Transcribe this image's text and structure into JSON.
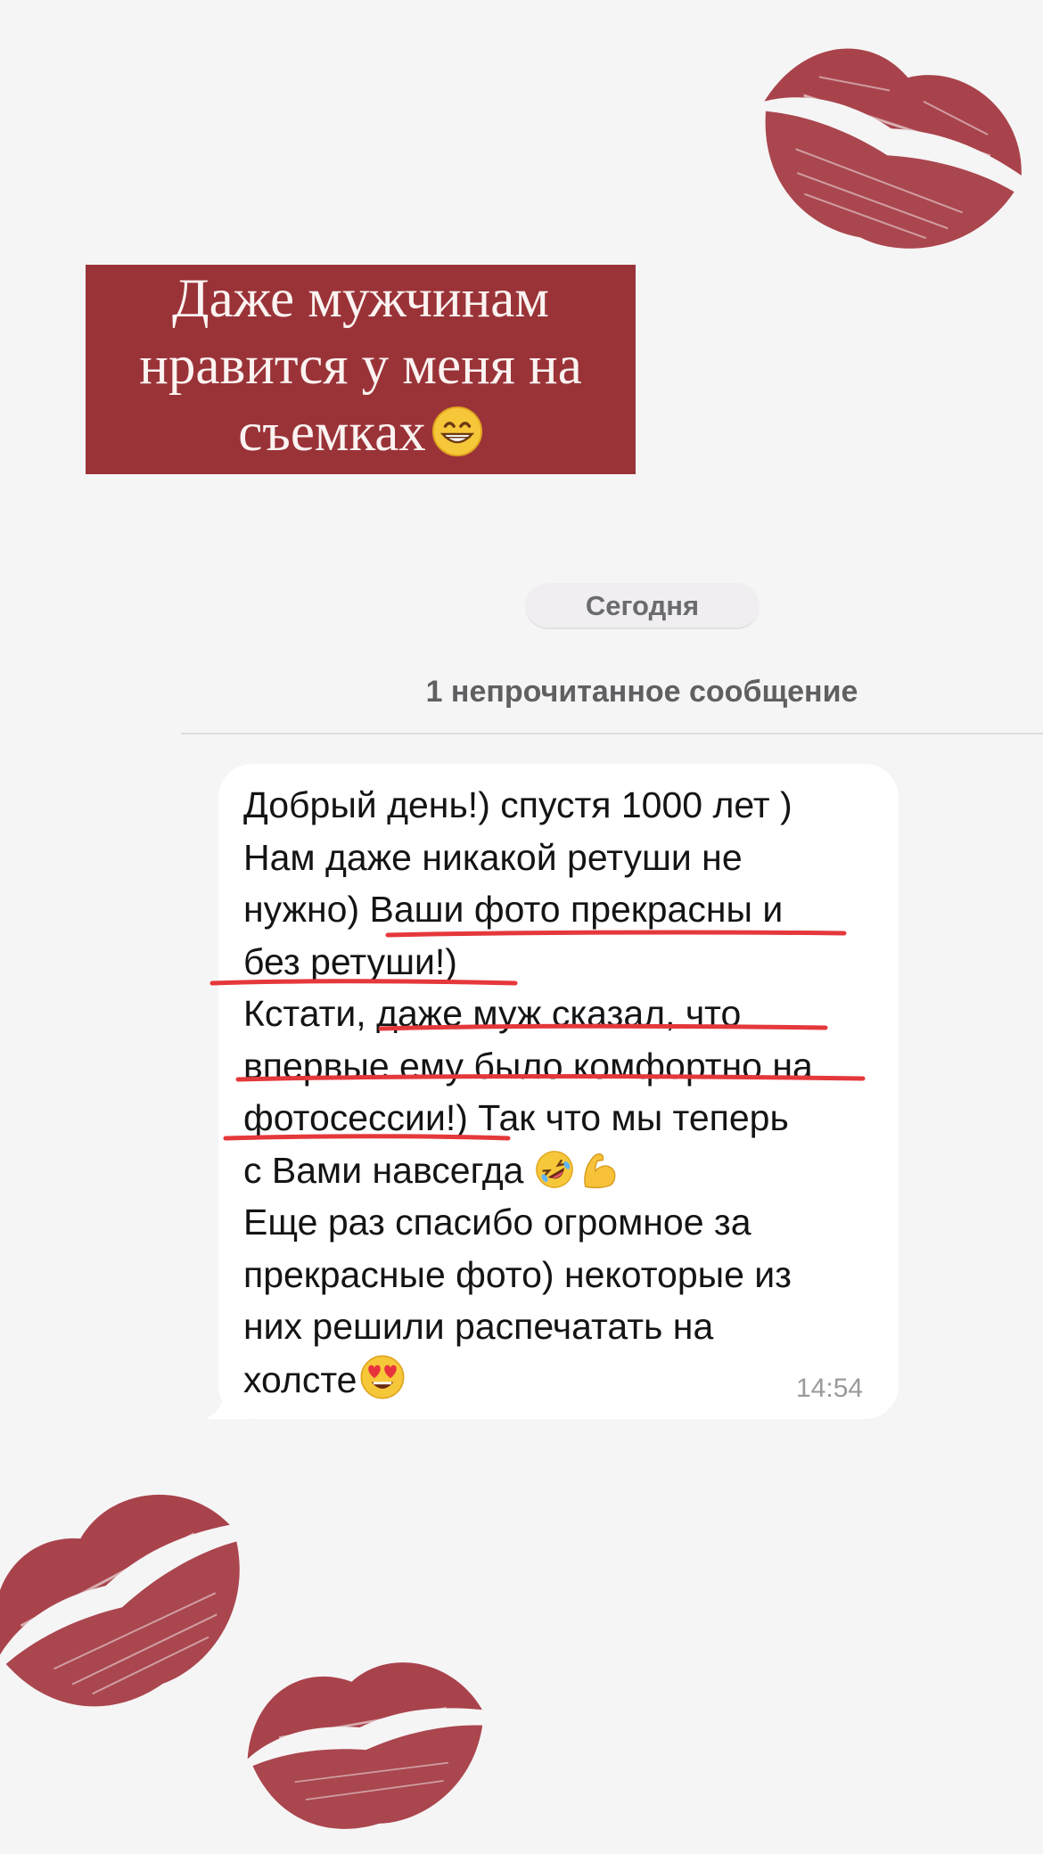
{
  "colors": {
    "background": "#f6f5f6",
    "banner": "#9a3338",
    "banner_text": "#fbf3f1",
    "lipstick": "#a2333c",
    "underline": "#e5383b",
    "bubble": "#ffffff"
  },
  "banner": {
    "lines": [
      "Даже мужчинам",
      "нравится у меня на",
      "съемках"
    ],
    "emoji": "grinning-face-with-smiling-eyes"
  },
  "chat": {
    "date_label": "Сегодня",
    "unread_label": "1 непрочитанное сообщение",
    "message": {
      "lines": [
        "Добрый день!) спустя 1000 лет )",
        "Нам даже никакой ретуши не",
        "нужно) Ваши фото прекрасны и",
        "без ретуши!)",
        "Кстати, даже муж сказал, что",
        "впервые ему было комфортно на",
        "фотосессии!) Так что мы теперь",
        "с Вами навсегда ",
        "Еще раз спасибо огромное за",
        "прекрасные фото) некоторые из",
        "них решили распечатать на",
        "холсте"
      ],
      "emojis_line_8": [
        "rolling-on-floor-laughing",
        "flexed-biceps"
      ],
      "emoji_line_12": "smiling-face-with-heart-eyes",
      "time": "14:54"
    }
  }
}
